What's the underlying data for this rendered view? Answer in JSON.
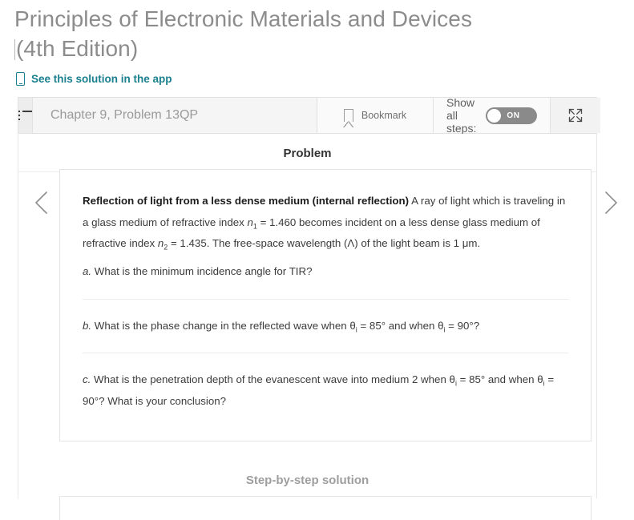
{
  "header": {
    "book_title_line1": "Principles of Electronic Materials and Devices",
    "book_title_line2": "(4th Edition)",
    "app_link_label": "See this solution in the app",
    "app_link_color": "#1a7f8e",
    "app_icon": "mobile-phone-icon"
  },
  "toolbar": {
    "menu_icon": "list-menu-icon",
    "chapter_label": "Chapter 9, Problem 13QP",
    "bookmark_icon": "bookmark-icon",
    "bookmark_label": "Bookmark",
    "show_all_steps_label": "Show all steps:",
    "toggle_state": "ON",
    "expand_icon": "expand-fullscreen-icon"
  },
  "nav": {
    "prev_icon": "chevron-left-icon",
    "next_icon": "chevron-right-icon"
  },
  "main": {
    "problem_heading": "Problem",
    "problem": {
      "bold_lead": "Reflection of light from a less dense medium (internal reflection)",
      "body_1": " A ray of light which is traveling in a glass medium of refractive index ",
      "n1_symbol": "n",
      "n1_sub": "1",
      "body_2": " = 1.460 becomes incident on a less dense glass medium of refractive index ",
      "n2_symbol": "n",
      "n2_sub": "2",
      "body_3": " = 1.435. The free-space wavelength (Λ) of the light beam is 1 μm."
    },
    "parts": [
      {
        "label": "a.",
        "text_1": " What is the minimum incidence angle for TIR?",
        "text_2": "",
        "text_3": ""
      },
      {
        "label": "b.",
        "text_1": " What is the phase change in the reflected wave when θ",
        "sub_1": "i",
        "text_2": " = 85° and when θ",
        "sub_2": "i",
        "text_3": " = 90°?"
      },
      {
        "label": "c.",
        "text_1": " What is the penetration depth of the evanescent wave into medium 2 when θ",
        "sub_1": "i",
        "text_2": " = 85° and when θ",
        "sub_2": "i",
        "text_3": " = 90°? What is your conclusion?"
      }
    ],
    "step_by_step_heading": "Step-by-step solution"
  }
}
